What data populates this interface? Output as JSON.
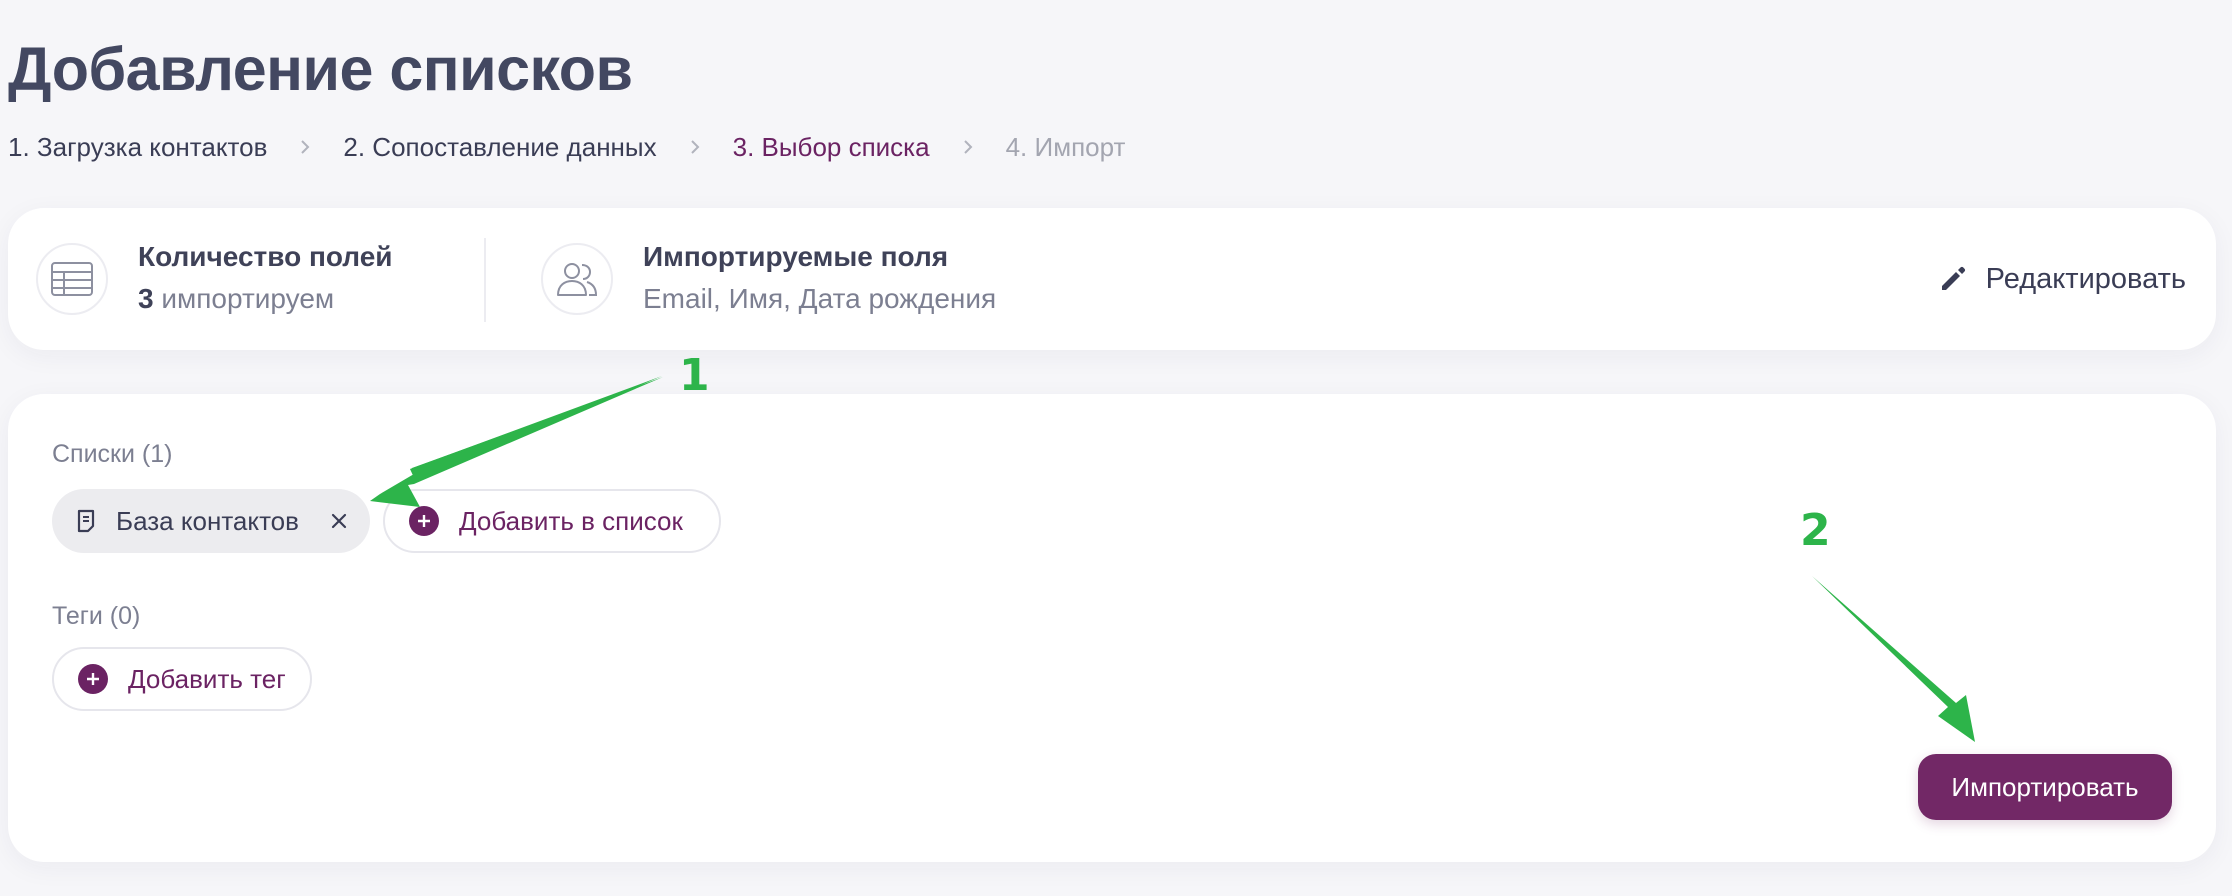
{
  "page": {
    "title": "Добавление списков"
  },
  "stepper": {
    "steps": [
      {
        "label": "1. Загрузка контактов",
        "state": "done"
      },
      {
        "label": "2. Сопоставление данных",
        "state": "done"
      },
      {
        "label": "3. Выбор списка",
        "state": "active"
      },
      {
        "label": "4. Импорт",
        "state": "pending"
      }
    ]
  },
  "summary": {
    "fields_count": {
      "title": "Количество полей",
      "number": "3",
      "suffix": " импортируем",
      "icon": "table-icon"
    },
    "imported_fields": {
      "title": "Импортируемые поля",
      "value": "Email, Имя, Дата рождения",
      "icon": "users-icon"
    },
    "edit_label": "Редактировать",
    "edit_icon": "pencil-icon"
  },
  "lists": {
    "label": "Списки (1)",
    "items": [
      {
        "name": "База контактов",
        "icon": "document-icon"
      }
    ],
    "add_label": "Добавить в список"
  },
  "tags": {
    "label": "Теги (0)",
    "add_label": "Добавить тег"
  },
  "import_button": {
    "label": "Импортировать"
  },
  "annotations": [
    {
      "label": "1",
      "color": "#2db44a"
    },
    {
      "label": "2",
      "color": "#2db44a"
    }
  ],
  "colors": {
    "accent": "#722866",
    "annotation": "#2db44a",
    "background": "#f6f6f9"
  }
}
